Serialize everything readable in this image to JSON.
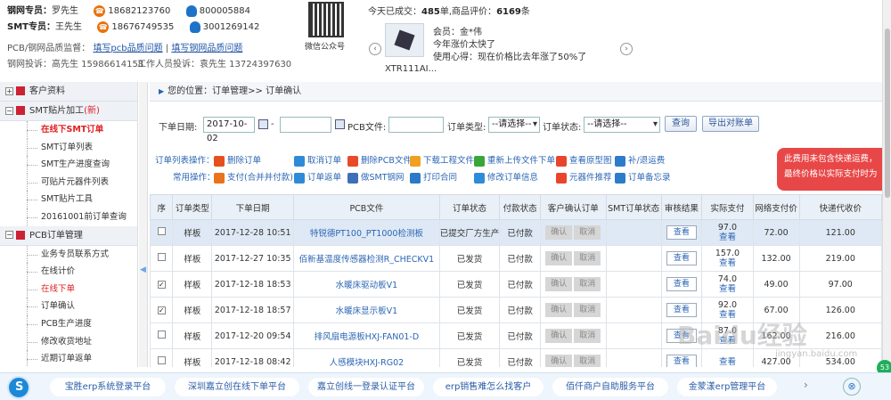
{
  "header": {
    "rep_label": "钢网专员：",
    "rep_name": "罗先生",
    "rep_phone": "18682123760",
    "rep_qq": "800005884",
    "smt_label": "SMT专员：",
    "smt_name": "王先生",
    "smt_phone": "18676749535",
    "smt_qq": "3001269142",
    "quality_label": "PCB/钢网品质atal：",
    "quality_link1": "填写pcb品质问题",
    "quality_sep": "|",
    "quality_link2": "填写钢网品质问题",
    "complaint": "钢网投诉：高先生 15986614158",
    "staff": "工作人员投诉：袁先生 13724397630",
    "qr_label": "微信公众号",
    "today_prefix": "今天已成交：",
    "today_count": "485",
    "today_mid": "单,商品评价：",
    "review_count": "6169",
    "review_suffix": "条",
    "member": "会员：金*伟",
    "review_line1": "今年涨价太快了",
    "review_line2": "使用心得：现在价格比去年涨了50%了",
    "product_name": "XTR111AI...",
    "prev_arrow": "‹",
    "next_arrow": "›"
  },
  "sidebar": {
    "groups": [
      {
        "label": "客户资料",
        "badge": ""
      },
      {
        "label": "SMT贴片加工",
        "badge": "(新)"
      },
      {
        "label": "PCB订单管理",
        "badge": ""
      }
    ],
    "smt_items": [
      "在线下SMT订单",
      "SMT订单列表",
      "SMT生产进度查询",
      "可贴片元器件列表",
      "SMT贴片工具",
      "20161001前订单查询"
    ],
    "pcb_items": [
      "业务专员联系方式",
      "在线计价",
      "在线下单",
      "订单确认",
      "PCB生产进度",
      "修改收货地址",
      "近期订单返单"
    ]
  },
  "breadcrumb": "您的位置：订单管理>> 订单确认",
  "filters": {
    "date_label": "下单日期:",
    "date_from": "2017-10-02",
    "dash": "-",
    "date_to": "",
    "pcb_label": "PCB文件:",
    "pcb_value": "",
    "type_label": "订单类型:",
    "type_value": "--请选择--",
    "status_label": "订单状态:",
    "status_value": "--请选择--",
    "query": "查询",
    "export": "导出对账单"
  },
  "actions": {
    "row1_label": "订单列表操作：",
    "row1": [
      "删除订单",
      "取消订单",
      "删除PCB文件",
      "下载工程文件",
      "重新上传文件下单",
      "查看原型图",
      "补/退运费"
    ],
    "row2_label": "常用操作：",
    "row2": [
      "支付(合并并付款)",
      "订单返单",
      "做SMT钢网",
      "打印合同",
      "修改订单信息",
      "元器件推荐",
      "订单备忘录"
    ],
    "notice_line1": "此费用未包含快递运费，",
    "notice_line2": "最终价格以实际支付时为"
  },
  "table": {
    "headers": [
      "序",
      "订单类型",
      "下单日期",
      "PCB文件",
      "订单状态",
      "付款状态",
      "客户确认订单",
      "SMT订单状态",
      "审核结果",
      "实际支付",
      "网络支付价",
      "快递代收价"
    ],
    "confirm_label": "确认",
    "cancel_label": "取消",
    "view_label": "查看",
    "rows": [
      {
        "checked": "",
        "type": "样板",
        "date": "2017-12-28 10:51",
        "file": "特锐德PT100_PT1000检测板",
        "status": "已提交厂方生产",
        "pay": "已付款",
        "smt": "",
        "actual": "97.0",
        "net": "72.00",
        "cod": "121.00"
      },
      {
        "checked": "",
        "type": "样板",
        "date": "2017-12-27 10:35",
        "file": "佰新基温度传感器检测R_CHECKV1",
        "status": "已发货",
        "pay": "已付款",
        "smt": "",
        "actual": "157.0",
        "net": "132.00",
        "cod": "219.00"
      },
      {
        "checked": "✓",
        "type": "样板",
        "date": "2017-12-18 18:53",
        "file": "水暖床驱动板V1",
        "status": "已发货",
        "pay": "已付款",
        "smt": "",
        "actual": "74.0",
        "net": "49.00",
        "cod": "97.00"
      },
      {
        "checked": "✓",
        "type": "样板",
        "date": "2017-12-18 18:57",
        "file": "水暖床显示板V1",
        "status": "已发货",
        "pay": "已付款",
        "smt": "",
        "actual": "92.0",
        "net": "67.00",
        "cod": "126.00"
      },
      {
        "checked": "",
        "type": "样板",
        "date": "2017-12-20 09:54",
        "file": "排风扇电源板HXJ-FAN01-D",
        "status": "已发货",
        "pay": "已付款",
        "smt": "",
        "actual": "87.0",
        "net": "162.00",
        "cod": "216.00"
      },
      {
        "checked": "",
        "type": "样板",
        "date": "2017-12-18 08:42",
        "file": "人感模块HXJ-RG02",
        "status": "已发货",
        "pay": "已付款",
        "smt": "",
        "actual": "",
        "net": "427.00",
        "cod": "534.00"
      }
    ]
  },
  "bottombar": {
    "links": [
      "宝胜erp系统登录平台",
      "深圳嘉立创在线下单平台",
      "嘉立创线一登录认证平台",
      "erp销售难怎么找客户",
      "佰仟商户自助服务平台",
      "金蒙漾erp管理平台"
    ],
    "next": "›",
    "close": "⊗"
  },
  "side_badge": "53",
  "watermark": "Baidu经验",
  "watermark_sub": "jingyan.baidu.com"
}
